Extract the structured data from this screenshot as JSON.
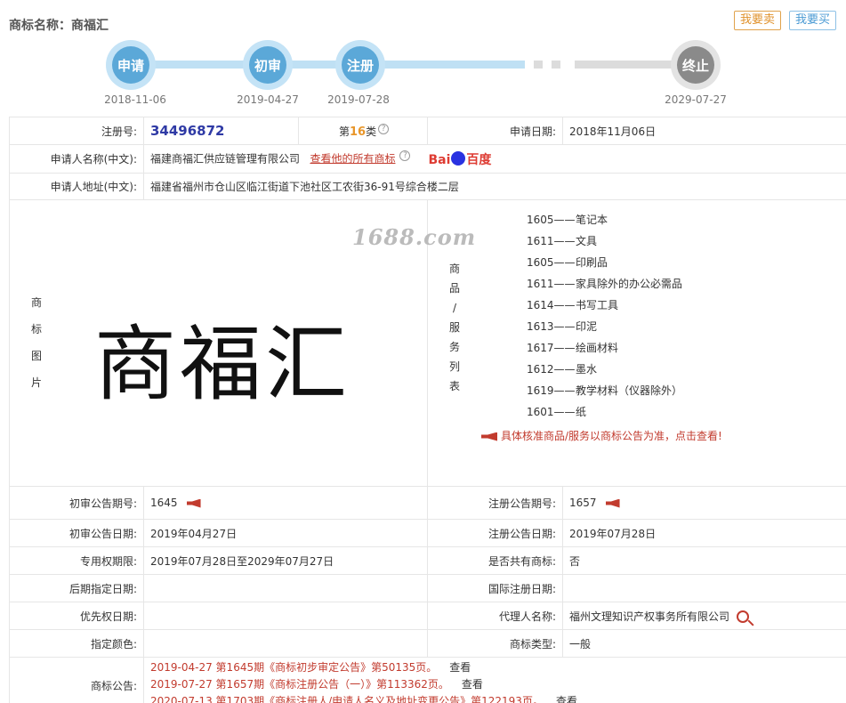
{
  "header": {
    "label": "商标名称：",
    "name": "商福汇",
    "sell": "我要卖",
    "buy": "我要买"
  },
  "timeline": [
    {
      "label": "申请",
      "date": "2018-11-06",
      "status": "done"
    },
    {
      "label": "初审",
      "date": "2019-04-27",
      "status": "done"
    },
    {
      "label": "注册",
      "date": "2019-07-28",
      "status": "done"
    },
    {
      "label": "终止",
      "date": "2029-07-27",
      "status": "pending"
    }
  ],
  "colors": {
    "accent_blue": "#5ba8d8",
    "accent_red": "#c23b2e",
    "reg_no": "#2f3aa5",
    "class_orange": "#e8962a"
  },
  "info": {
    "reg_no_label": "注册号:",
    "reg_no": "34496872",
    "class_prefix": "第",
    "class_num": "16",
    "class_suffix": "类",
    "apply_date_label": "申请日期:",
    "apply_date": "2018年11月06日",
    "applicant_label": "申请人名称(中文):",
    "applicant": "福建商福汇供应链管理有限公司",
    "view_all": "查看他的所有商标",
    "baidu": "Bai",
    "baidu2": "百度",
    "address_label": "申请人地址(中文):",
    "address": "福建省福州市仓山区临江街道下池社区工农街36-91号综合楼二层",
    "image_label": [
      "商",
      "标",
      "图",
      "片"
    ],
    "mark_text": "商福汇",
    "watermark": "1688.com",
    "goods_label": [
      "商",
      "品",
      "/",
      "服",
      "务",
      "列",
      "表"
    ],
    "goods": [
      {
        "code": "1605——",
        "name": "笔记本"
      },
      {
        "code": "1611——",
        "name": "文具"
      },
      {
        "code": "1605——",
        "name": "印刷品"
      },
      {
        "code": "1611——",
        "name": "家具除外的办公必需品"
      },
      {
        "code": "1614——",
        "name": "书写工具"
      },
      {
        "code": "1613——",
        "name": "印泥"
      },
      {
        "code": "1617——",
        "name": "绘画材料"
      },
      {
        "code": "1612——",
        "name": "墨水"
      },
      {
        "code": "1619——",
        "name": "教学材料（仪器除外）"
      },
      {
        "code": "1601——",
        "name": "纸"
      }
    ],
    "goods_notice": "具体核准商品/服务以商标公告为准，点击查看!",
    "prelim_no_label": "初审公告期号:",
    "prelim_no": "1645",
    "reg_pub_no_label": "注册公告期号:",
    "reg_pub_no": "1657",
    "prelim_date_label": "初审公告日期:",
    "prelim_date": "2019年04月27日",
    "reg_pub_date_label": "注册公告日期:",
    "reg_pub_date": "2019年07月28日",
    "exclusive_label": "专用权期限:",
    "exclusive": "2019年07月28日至2029年07月27日",
    "shared_label": "是否共有商标:",
    "shared": "否",
    "later_label": "后期指定日期:",
    "later": "",
    "intl_label": "国际注册日期:",
    "intl": "",
    "priority_label": "优先权日期:",
    "priority": "",
    "agent_label": "代理人名称:",
    "agent": "福州文理知识产权事务所有限公司",
    "color_label": "指定颜色:",
    "color": "",
    "type_label": "商标类型:",
    "type": "一般",
    "pub_label": "商标公告:",
    "announcements": [
      {
        "text": "2019-04-27 第1645期《商标初步审定公告》第50135页。",
        "view": "查看"
      },
      {
        "text": "2019-07-27 第1657期《商标注册公告（一）》第113362页。",
        "view": "查看"
      },
      {
        "text": "2020-07-13 第1703期《商标注册人/申请人名义及地址变更公告》第122193页。",
        "view": "查看"
      }
    ]
  }
}
